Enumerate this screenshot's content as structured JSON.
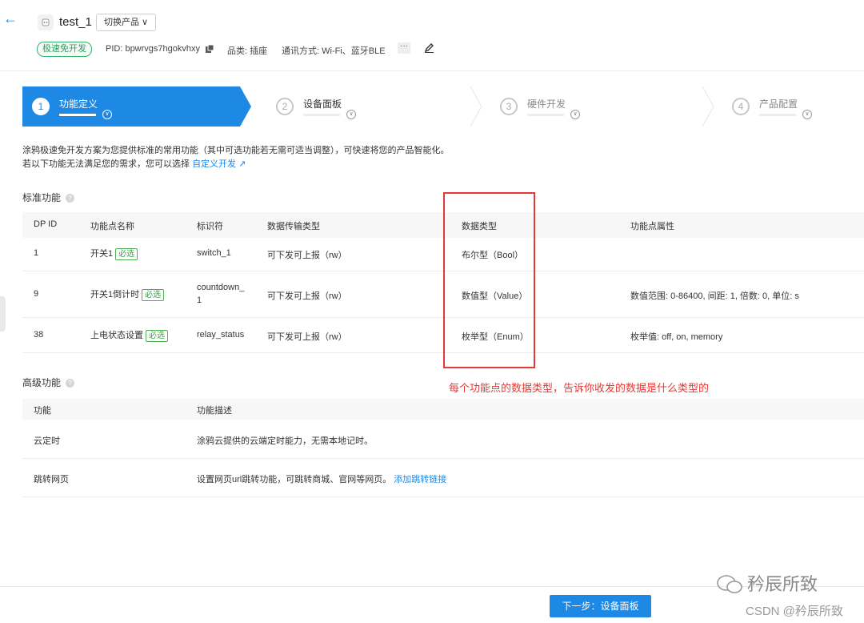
{
  "header": {
    "product_name": "test_1",
    "switch_label": "切换产品 ∨",
    "tag": "极速免开发",
    "pid": "PID: bpwrvgs7hgokvhxy",
    "category": "品类: 插座",
    "comm": "通讯方式: Wi-Fi、蓝牙BLE",
    "more": "···"
  },
  "steps": [
    {
      "num": "1",
      "label": "功能定义"
    },
    {
      "num": "2",
      "label": "设备面板"
    },
    {
      "num": "3",
      "label": "硬件开发"
    },
    {
      "num": "4",
      "label": "产品配置"
    }
  ],
  "intro": {
    "line1": "涂鸦极速免开发方案为您提供标准的常用功能（其中可选功能若无需可适当调整），可快速将您的产品智能化。",
    "line2_prefix": "若以下功能无法满足您的需求，您可以选择",
    "line2_link": "自定义开发"
  },
  "standard": {
    "title": "标准功能",
    "headers": [
      "DP ID",
      "功能点名称",
      "标识符",
      "数据传输类型",
      "数据类型",
      "功能点属性"
    ],
    "required_label": "必选",
    "rows": [
      {
        "id": "1",
        "name": "开关1",
        "code": "switch_1",
        "code2": "",
        "trans": "可下发可上报（rw）",
        "type": "布尔型（Bool）",
        "attr": ""
      },
      {
        "id": "9",
        "name": "开关1倒计时",
        "code": "countdown_",
        "code2": "1",
        "trans": "可下发可上报（rw）",
        "type": "数值型（Value）",
        "attr": "数值范围: 0-86400, 间距: 1, 倍数: 0, 单位: s"
      },
      {
        "id": "38",
        "name": "上电状态设置",
        "code": "relay_status",
        "code2": "",
        "trans": "可下发可上报（rw）",
        "type": "枚举型（Enum）",
        "attr": "枚举值: off, on, memory"
      }
    ]
  },
  "annotation": "每个功能点的数据类型，告诉你收发的数据是什么类型的",
  "advanced": {
    "title": "高级功能",
    "headers": [
      "功能",
      "功能描述"
    ],
    "rows": [
      {
        "name": "云定时",
        "desc": "涂鸦云提供的云端定时能力，无需本地记时。",
        "link": ""
      },
      {
        "name": "跳转网页",
        "desc": "设置网页url跳转功能，可跳转商城、官网等网页。",
        "link": "添加跳转链接"
      }
    ]
  },
  "footer": {
    "next": "下一步：设备面板",
    "watermark1": "矜辰所致",
    "watermark2": "CSDN @矜辰所致"
  },
  "colors": {
    "accent": "#1e88e5",
    "annotation": "#e53935",
    "tag_green": "#34b36b"
  }
}
